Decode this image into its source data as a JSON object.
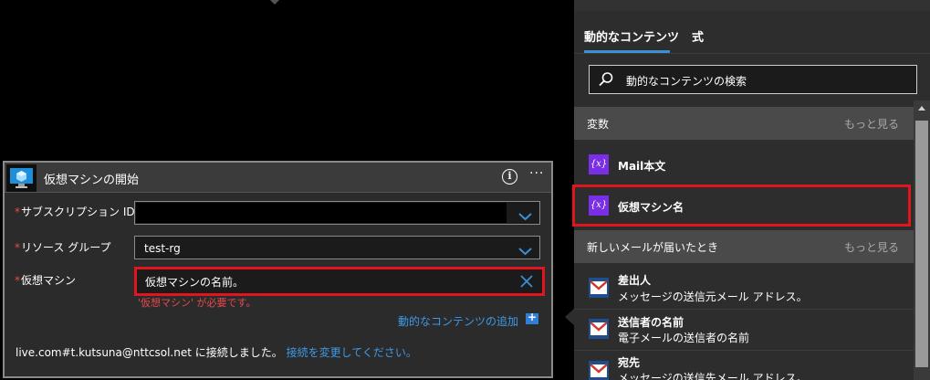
{
  "action": {
    "title": "仮想マシンの開始",
    "fields": [
      {
        "label": "サブスクリプション ID",
        "value": ""
      },
      {
        "label": "リソース グループ",
        "value": "test-rg"
      },
      {
        "label": "仮想マシン",
        "value": "仮想マシンの名前。"
      }
    ],
    "required_marker": "*",
    "error_message": "'仮想マシン' が必要です。",
    "dynamic_content_link": "動的なコンテンツの追加",
    "connection_text": "live.com#t.kutsuna@nttcsol.net に接続しました。",
    "change_connection_link": "接続を変更してください。"
  },
  "panel": {
    "tabs": [
      "動的なコンテンツ",
      "式"
    ],
    "active_tab": 0,
    "search_placeholder": "動的なコンテンツの検索",
    "sections": [
      {
        "title": "変数",
        "more": "もっと見る",
        "items": [
          {
            "icon": "variable-icon",
            "icon_text": "{x}",
            "title": "Mail本文"
          },
          {
            "icon": "variable-icon",
            "icon_text": "{x}",
            "title": "仮想マシン名"
          }
        ]
      },
      {
        "title": "新しいメールが届いたとき",
        "more": "もっと見る",
        "items": [
          {
            "icon": "mail-icon",
            "title": "差出人",
            "subtitle": "メッセージの送信元メール アドレス。"
          },
          {
            "icon": "mail-icon",
            "title": "送信者の名前",
            "subtitle": "電子メールの送信者の名前"
          },
          {
            "icon": "mail-icon",
            "title": "宛先",
            "subtitle": "メッセージの送信先メール アドレス。"
          }
        ]
      }
    ]
  },
  "colors": {
    "accent": "#3a8fd6",
    "error": "#e0151d",
    "variable": "#7a2ee6",
    "link": "#3d9ae8"
  }
}
